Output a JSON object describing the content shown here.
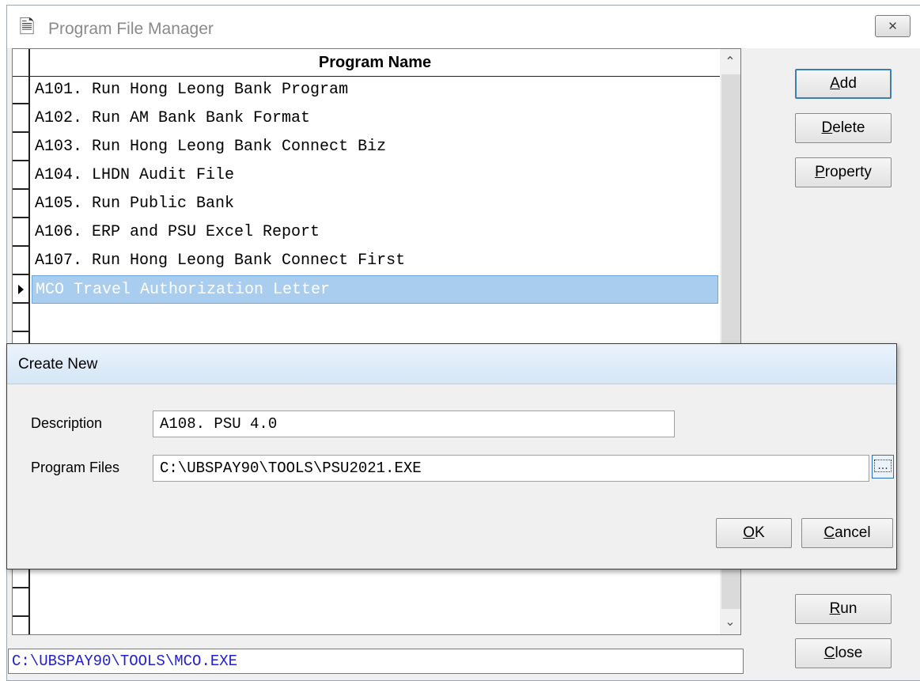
{
  "window": {
    "title": "Program File Manager",
    "close_label": "✕"
  },
  "grid": {
    "header": "Program Name",
    "rows": [
      "A101. Run Hong Leong Bank Program",
      "A102. Run AM Bank Bank Format",
      "A103. Run Hong Leong Bank Connect Biz",
      "A104. LHDN Audit File",
      "A105. Run Public Bank",
      "A106. ERP and PSU Excel Report",
      "A107. Run Hong Leong Bank Connect First",
      "MCO Travel Authorization Letter"
    ],
    "selected_index": 7,
    "scroll_up": "⌃",
    "scroll_down": "⌄"
  },
  "buttons": {
    "add_key": "A",
    "add_rest": "dd",
    "delete_key": "D",
    "delete_rest": "elete",
    "property_key": "P",
    "property_rest": "roperty",
    "run_key": "R",
    "run_rest": "un",
    "close_key": "C",
    "close_rest": "lose"
  },
  "path": "C:\\UBSPAY90\\TOOLS\\MCO.EXE",
  "dialog": {
    "title": "Create New",
    "description_label": "Description",
    "description_value": "A108. PSU 4.0",
    "program_files_label": "Program Files",
    "program_files_value": "C:\\UBSPAY90\\TOOLS\\PSU2021.EXE",
    "browse_label": "...",
    "ok_key": "O",
    "ok_rest": "K",
    "cancel_key": "C",
    "cancel_rest": "ancel"
  },
  "colors": {
    "selection": "#a9cdee",
    "path_text": "#2020d0",
    "default_button_border": "#3c7fb1"
  }
}
